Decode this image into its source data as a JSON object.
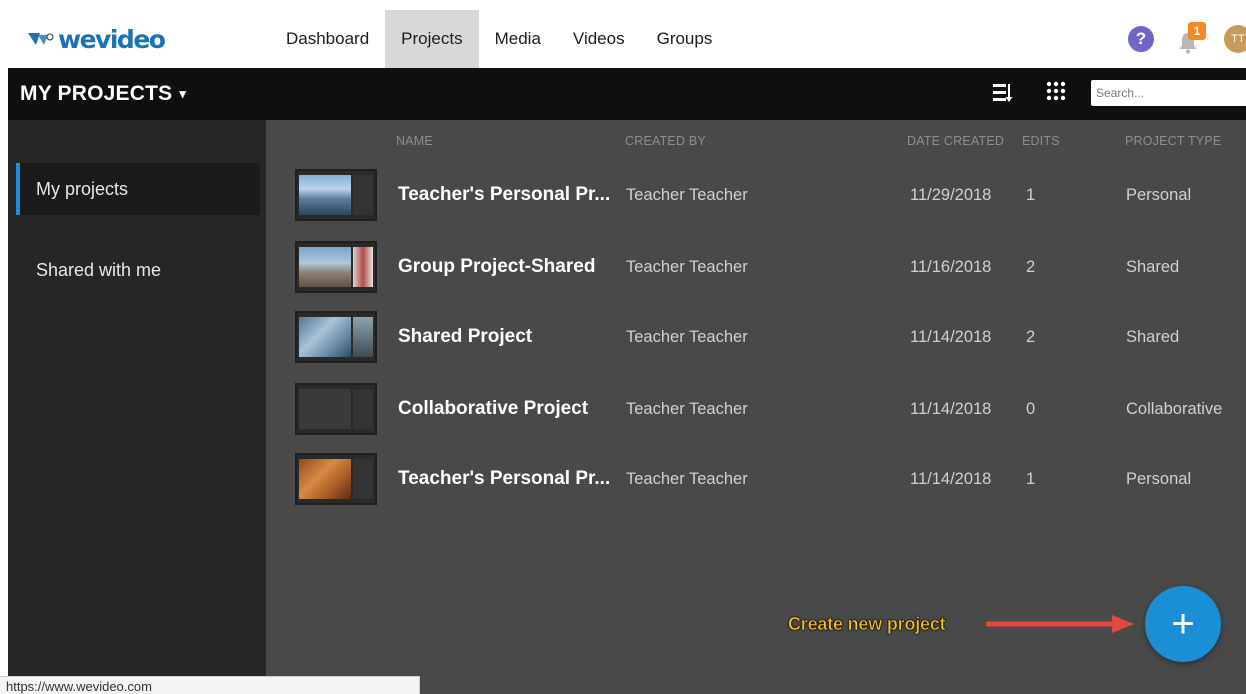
{
  "brand": {
    "logo_text": "WeVideo",
    "accent": "#1a8fd6",
    "logo_color": "#1a73b5"
  },
  "nav": {
    "items": [
      {
        "label": "Dashboard",
        "active": false
      },
      {
        "label": "Projects",
        "active": true
      },
      {
        "label": "Media",
        "active": false
      },
      {
        "label": "Videos",
        "active": false
      },
      {
        "label": "Groups",
        "active": false
      }
    ],
    "help_symbol": "?",
    "notification_count": "1",
    "avatar_initials": "TT"
  },
  "header": {
    "title": "MY PROJECTS",
    "caret": "▾",
    "search_placeholder": "Search..."
  },
  "sidebar": {
    "items": [
      {
        "label": "My projects",
        "active": true
      },
      {
        "label": "Shared with me",
        "active": false
      }
    ]
  },
  "table": {
    "columns": {
      "name": "NAME",
      "created_by": "CREATED BY",
      "date_created": "DATE CREATED",
      "edits": "EDITS",
      "project_type": "PROJECT TYPE"
    },
    "rows": [
      {
        "name": "Teacher's Personal Pr...",
        "created_by": "Teacher Teacher",
        "date": "11/29/2018",
        "edits": "1",
        "type": "Personal",
        "thumb": "city-skyline"
      },
      {
        "name": "Group Project-Shared",
        "created_by": "Teacher Teacher",
        "date": "11/16/2018",
        "edits": "2",
        "type": "Shared",
        "thumb": "landscape"
      },
      {
        "name": "Shared Project",
        "created_by": "Teacher Teacher",
        "date": "11/14/2018",
        "edits": "2",
        "type": "Shared",
        "thumb": "ice"
      },
      {
        "name": "Collaborative Project",
        "created_by": "Teacher Teacher",
        "date": "11/14/2018",
        "edits": "0",
        "type": "Collaborative",
        "thumb": "empty"
      },
      {
        "name": "Teacher's Personal Pr...",
        "created_by": "Teacher Teacher",
        "date": "11/14/2018",
        "edits": "1",
        "type": "Personal",
        "thumb": "canyon"
      }
    ]
  },
  "annotation": {
    "text": "Create new project"
  },
  "fab": {
    "symbol": "+"
  },
  "status_bar": {
    "url": "https://www.wevideo.com"
  }
}
